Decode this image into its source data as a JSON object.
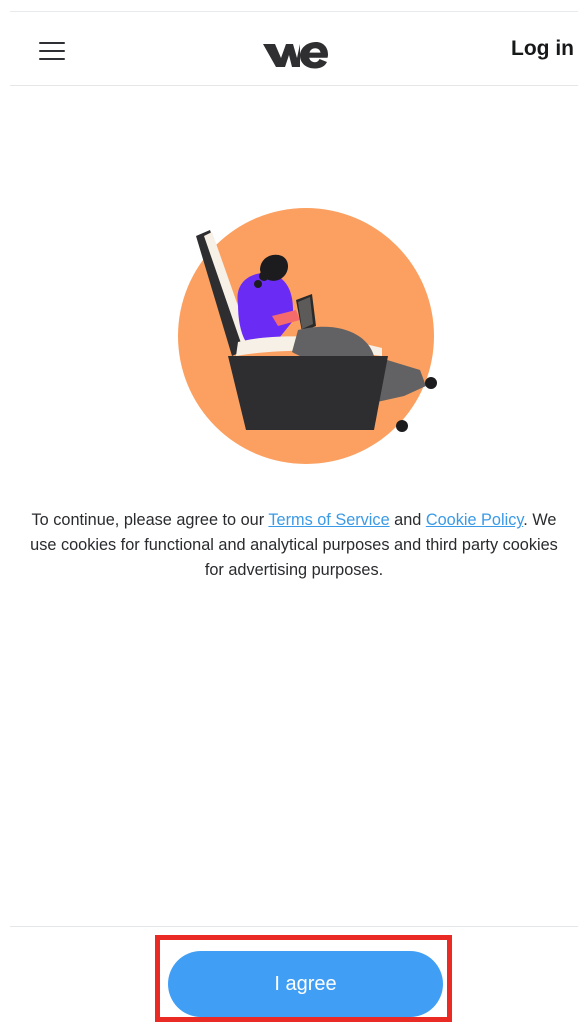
{
  "header": {
    "menu_icon": "hamburger-menu-icon",
    "logo_icon": "wetransfer-we-logo",
    "login_label": "Log in"
  },
  "illustration": {
    "name": "person-reading-in-armchair",
    "colors": {
      "circle": "#FBA060",
      "chair": "#2E2E30",
      "cushion": "#F6F0E6",
      "shirt": "#6A2CF5",
      "pants": "#626264",
      "book": "#2A2A2A"
    }
  },
  "consent": {
    "text_before": "To continue, please agree to our ",
    "terms_link": "Terms of Service",
    "text_mid1": " and ",
    "cookie_link": "Cookie Policy",
    "text_after": ". We use cookies for functional and analytical purposes and third party cookies for advertising purposes."
  },
  "footer": {
    "agree_label": "I agree"
  },
  "colors": {
    "accent": "#409FF5",
    "link": "#3B9AE6",
    "highlight_frame": "#EA2B25"
  }
}
